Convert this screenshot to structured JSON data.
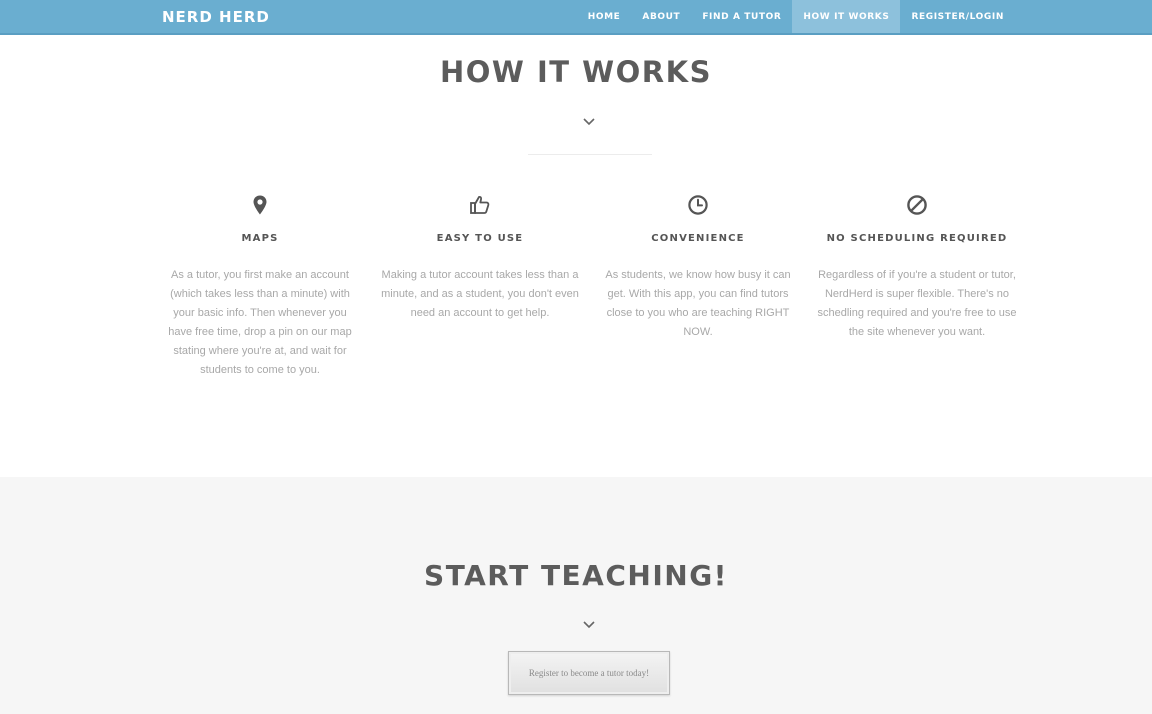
{
  "nav": {
    "brand": "NERD HERD",
    "links": [
      {
        "label": "HOME"
      },
      {
        "label": "ABOUT"
      },
      {
        "label": "FIND A TUTOR"
      },
      {
        "label": "HOW IT WORKS",
        "active": true
      },
      {
        "label": "REGISTER/LOGIN"
      }
    ]
  },
  "how_it_works": {
    "title": "HOW IT WORKS",
    "features": [
      {
        "icon": "map-pin-icon",
        "name": "MAPS",
        "description": "As a tutor, you first make an account (which takes less than a minute) with your basic info. Then whenever you have free time, drop a pin on our map stating where you're at, and wait for students to come to you."
      },
      {
        "icon": "thumbs-up-icon",
        "name": "EASY TO USE",
        "description": "Making a tutor account takes less than a minute, and as a student, you don't even need an account to get help."
      },
      {
        "icon": "clock-icon",
        "name": "CONVENIENCE",
        "description": "As students, we know how busy it can get. With this app, you can find tutors close to you who are teaching RIGHT NOW."
      },
      {
        "icon": "no-sign-icon",
        "name": "NO SCHEDULING REQUIRED",
        "description": "Regardless of if you're a student or tutor, NerdHerd is super flexible. There's no schedling required and you're free to use the site whenever you want."
      }
    ]
  },
  "start_teaching": {
    "title": "START TEACHING!",
    "button_label": "Register to become a tutor today!"
  },
  "colors": {
    "navbar": "#6aaed0",
    "nav_active": "#8dc1dc",
    "heading": "#5c5c5c",
    "body_text": "#a8a8a8",
    "section_bg": "#f6f6f6"
  }
}
